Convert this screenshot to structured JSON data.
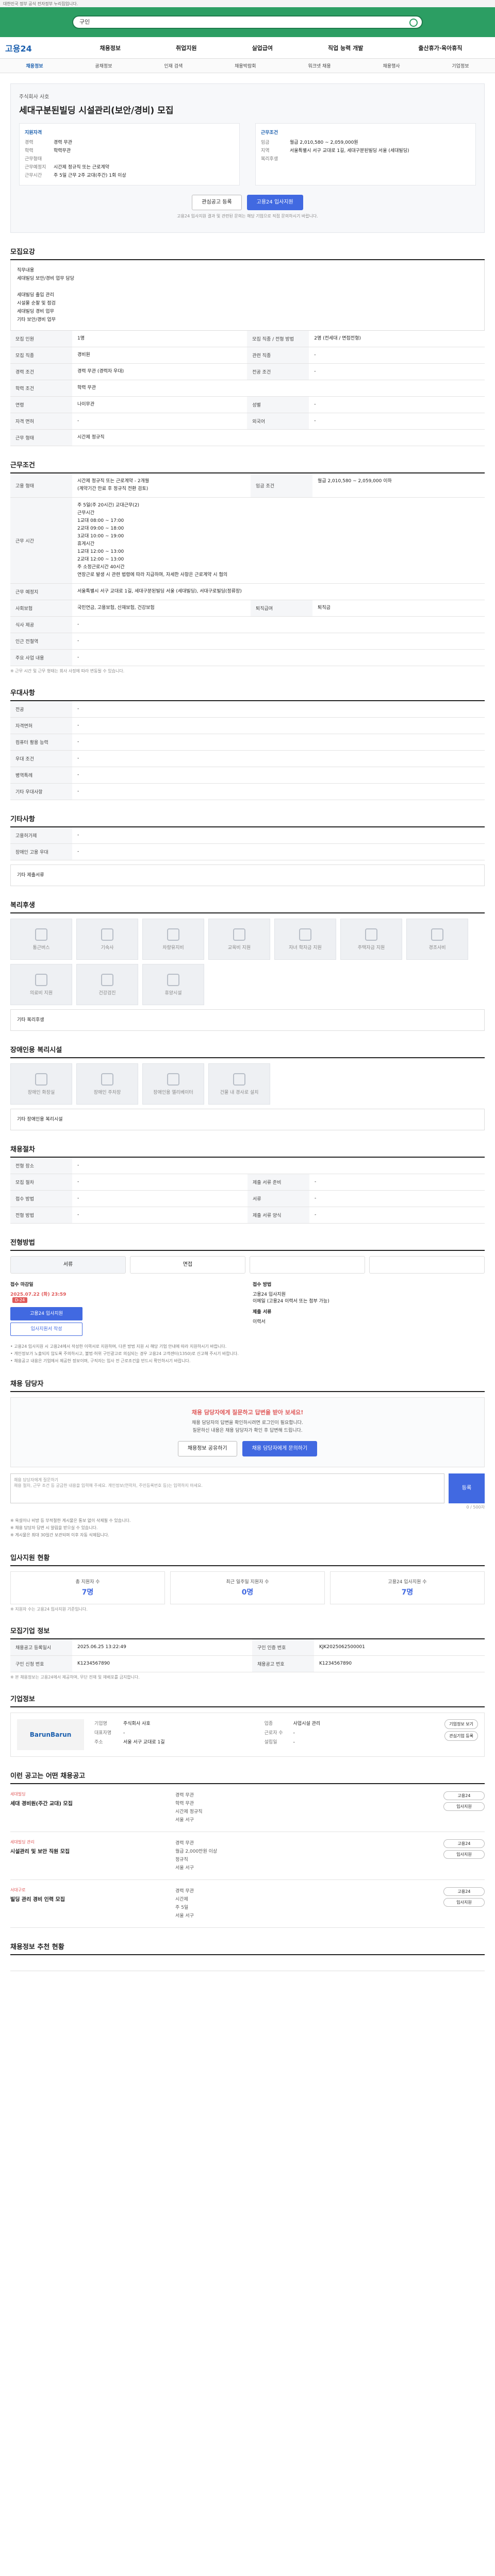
{
  "topbar": {
    "text": "대한민국 정부 공식 전자정부 누리집입니다."
  },
  "search": {
    "value": "구인"
  },
  "header": {
    "logo": "고용24",
    "gnb": [
      "채용정보",
      "취업지원",
      "실업급여",
      "직업 능력 개발",
      "출산휴가·육아휴직"
    ]
  },
  "subnav": [
    "채용정보",
    "공채정보",
    "인재 검색",
    "채용박람회",
    "워크넷 채용",
    "채용행사",
    "기업정보"
  ],
  "job": {
    "company": "주식회사 사호",
    "title": "세대구분된빌딩 시설관리(보안/경비) 모집",
    "left_header": "지원자격",
    "left": [
      {
        "k": "경력",
        "v": "경력 무관"
      },
      {
        "k": "학력",
        "v": "학력무관"
      },
      {
        "k": "",
        "v": ""
      },
      {
        "k": "근무형태",
        "v": ""
      },
      {
        "k": "근무예정지",
        "v": "시간제 정규직 또는 근로계약"
      },
      {
        "k": "근무시간",
        "v": "주 5일 근무 2주 교대(주간) 1회 이상"
      }
    ],
    "right_header": "근무조건",
    "right": [
      {
        "k": "임금",
        "v": "월급 2,010,580 ~ 2,059,000원"
      },
      {
        "k": "지역",
        "v": "서울특별시 서구 교대로 1길, 세대구분된빌딩 서울 (세대빌딩)"
      },
      {
        "k": "",
        "v": ""
      },
      {
        "k": "복리후생",
        "v": ""
      }
    ],
    "bookmark": "관심공고 등록",
    "apply": "고용24 입사지원",
    "notice": "고용24 입사지원 결과 및 관련된 문의는 해당 기업으로 직접 문의하시기 바랍니다."
  },
  "sections": {
    "duty": "모집요강",
    "conditions": "근무조건",
    "qualify": "우대사항",
    "etc": "기타사항",
    "welfare": "복리후생",
    "disabled": "장애인용 복리시설",
    "process": "채용절차",
    "apply_method": "전형방법",
    "qa": "채용 담당자",
    "stats": "입사지원 현황",
    "job_info": "모집기업 정보",
    "company": "기업정보",
    "recommend": "이런 공고는 어떤 채용공고"
  },
  "duty": {
    "desc": "직무내용\n세대빌딩 보안/경비 업무 담당\n\n세대빌딩 출입 관리\n시설물 순찰 및 점검\n세대빌딩 경비 업무\n기타 보안/경비 업무",
    "rows": [
      {
        "k": "모집 인원",
        "v": "1명",
        "k2": "모집 직종 / 전형 방법",
        "v2": "2명 (전세대 / 면접전형)"
      },
      {
        "k": "모집 직종",
        "v": "경비원",
        "k2": "관련 직종",
        "v2": "-"
      },
      {
        "k": "경력 조건",
        "v": "경력 무관 (경력자 우대)",
        "k2": "전공 조건",
        "v2": "-"
      },
      {
        "k": "학력 조건",
        "v": "학력 무관",
        "k2": "",
        "v2": ""
      },
      {
        "k": "연령",
        "v": "나이무관",
        "k2": "성별",
        "v2": "-"
      },
      {
        "k": "자격 면허",
        "v": "-",
        "k2": "외국어",
        "v2": "-"
      },
      {
        "k": "근무 형태",
        "v": "시간제 정규직",
        "k2": "",
        "v2": ""
      }
    ]
  },
  "cond": {
    "rows": [
      {
        "k": "고용 형태",
        "v": "시간제 정규직 또는 근로계약 - 2개월\n(계약기간 만료 후 정규직 전환 검토)",
        "k2": "임금 조건",
        "v2": "월급 2,010,580 ~ 2,059,000 이하"
      },
      {
        "k": "근무 시간",
        "v": "주 5일(주 20시간) 교대근무(2)\n근무시간\n1교대 08:00 ~ 17:00\n2교대 09:00 ~ 18:00\n3교대 10:00 ~ 19:00\n휴게시간\n1교대 12:00 ~ 13:00\n2교대 12:00 ~ 13:00\n주 소정근로시간 40시간\n연장근로 발생 시 관련 법령에 따라 지급하며, 자세한 사항은 근로계약 시 협의",
        "k2": "",
        "v2": ""
      },
      {
        "k": "근무 예정지",
        "v": "서울특별시 서구 교대로 1길, 세대구분된빌딩 서울 (세대빌딩), 서대구로빌딩(정류장)",
        "k2": "",
        "v2": ""
      },
      {
        "k": "사회보험",
        "v": "국민연금, 고용보험, 산재보험, 건강보험",
        "k2": "퇴직급여",
        "v2": "퇴직금"
      },
      {
        "k": "식사 제공",
        "v": "-",
        "k2": "",
        "v2": ""
      },
      {
        "k": "인근 전철역",
        "v": "-",
        "k2": "",
        "v2": ""
      },
      {
        "k": "주요 사업 내용",
        "v": "-",
        "k2": "",
        "v2": ""
      }
    ],
    "note": "※ 근무 시간 및 근무 형태는 회사 사정에 따라 변동될 수 있습니다."
  },
  "qualify": {
    "rows": [
      {
        "k": "전공",
        "v": "-"
      },
      {
        "k": "자격면허",
        "v": "-"
      },
      {
        "k": "컴퓨터 활용 능력",
        "v": "-"
      },
      {
        "k": "우대 조건",
        "v": "-"
      },
      {
        "k": "병역특례",
        "v": "-"
      },
      {
        "k": "기타 우대사항",
        "v": "-"
      }
    ]
  },
  "etc": {
    "rows": [
      {
        "k": "고용허가제",
        "v": "-"
      },
      {
        "k": "장애인 고용 우대",
        "v": "-"
      }
    ],
    "extra": "기타 제출서류"
  },
  "welfare": {
    "items": [
      "통근버스",
      "기숙사",
      "차량유지비",
      "교육비 지원",
      "자녀 학자금 지원",
      "주택자금 지원",
      "경조사비",
      "의료비 지원",
      "건강검진",
      "휴양시설"
    ],
    "extra_label": "기타 복리후생"
  },
  "disabled": {
    "items": [
      "장애인 화장실",
      "장애인 주차장",
      "장애인용 엘리베이터",
      "건물 내 경사로 설치"
    ],
    "extra_label": "기타 장애인용 복리시설"
  },
  "process": {
    "rows": [
      {
        "k": "전형 장소",
        "v": "-",
        "k2": "",
        "v2": ""
      },
      {
        "k": "모집 절차",
        "v": "-",
        "k2": "제출 서류 준비",
        "v2": "-"
      },
      {
        "k": "접수 방법",
        "v": "-",
        "k2": "서류",
        "v2": "-"
      },
      {
        "k": "전형 방법",
        "v": "-",
        "k2": "제출 서류 양식",
        "v2": "-"
      }
    ]
  },
  "apply": {
    "tabs": [
      "서류",
      "면접",
      "",
      ""
    ],
    "deadline_label": "접수 마감일",
    "deadline": "2025.07.22 (화) 23:59",
    "dday": "D-24",
    "apply_btn": "고용24 입사지원",
    "ghost_btn": "입사지원서 작성",
    "method_label": "접수 방법",
    "method_lines": [
      "고용24 입사지원",
      "이메일 (고용24 이력서 또는 첨부 가능)"
    ],
    "docs_label": "제출 서류",
    "docs": "이력서"
  },
  "notes": [
    "고용24 입사지원 시 고용24에서 작성한 이력서로 지원하며, 다른 방법 지원 시 해당 기업 안내에 따라 지원하시기 바랍니다.",
    "개인정보가 노출되지 않도록 주의하시고, 불법·허위 구인광고로 의심되는 경우 고용24 고객센터(1350)로 신고해 주시기 바랍니다.",
    "채용공고 내용은 기업에서 제공한 정보이며, 구직자는 입사 전 근로조건을 반드시 확인하시기 바랍니다."
  ],
  "qa": {
    "title": "채용 담당자에게 질문하고 답변을 받아 보세요!",
    "sub": "채용 담당자의 답변을 확인하시려면 로그인이 필요합니다.\n질문하신 내용은 채용 담당자가 확인 후 답변해 드립니다.",
    "btn1": "채용정보 공유하기",
    "btn2": "채용 담당자에게 문의하기",
    "placeholder": "채용 담당자에게 질문하기\n채용 절차, 근무 조건 등 궁금한 내용을 입력해 주세요. 개인정보(연락처, 주민등록번호 등)는 입력하지 마세요.",
    "count": "0 / 500자",
    "send": "등록",
    "footnotes": [
      "※ 욕설이나 비방 등 부적절한 게시물은 통보 없이 삭제될 수 있습니다.",
      "※ 채용 담당자 답변 시 알림을 받으실 수 있습니다.",
      "※ 게시물은 최대 30일간 보관되며 이후 자동 삭제됩니다."
    ]
  },
  "stats": {
    "items": [
      {
        "label": "총 지원자 수",
        "value": "7명"
      },
      {
        "label": "최근 일주일 지원자 수",
        "value": "0명"
      },
      {
        "label": "고용24 입사지원 수",
        "value": "7명"
      }
    ],
    "note": "※ 지원자 수는 고용24 입사지원 기준입니다."
  },
  "job_info": {
    "rows": [
      {
        "k": "채용공고 등록일시",
        "v": "2025.06.25 13:22:49",
        "k2": "구인 인증 번호",
        "v2": "KJK2025062500001"
      },
      {
        "k": "구인 신청 번호",
        "v": "K1234567890",
        "k2": "채용공고 번호",
        "v2": "K1234567890"
      }
    ],
    "note": "※ 본 채용정보는 고용24에서 제공하며, 무단 전재 및 재배포를 금지합니다."
  },
  "company": {
    "logo": "BarunBarun",
    "rows": [
      {
        "k": "기업명",
        "v": "주식회사 사호",
        "k2": "업종",
        "v2": "사업시설 관리"
      },
      {
        "k": "대표자명",
        "v": "-",
        "k2": "근로자 수",
        "v2": "-"
      },
      {
        "k": "주소",
        "v": "서울 서구 교대로 1길",
        "k2": "설립일",
        "v2": "-"
      }
    ],
    "btns": [
      "기업정보 보기",
      "관심기업 등록"
    ]
  },
  "recommend": [
    {
      "company": "세대빌딩",
      "title": "세대 경비원(주간 교대) 모집",
      "lines": [
        "경력 무관",
        "학력 무관",
        "시간제 정규직",
        "서울 서구"
      ],
      "btns": [
        "고용24",
        "입사지원"
      ]
    },
    {
      "company": "세대빌딩 관리",
      "title": "시설관리 및 보안 직원 모집",
      "lines": [
        "경력 무관",
        "월급 2,000만원 이상",
        "정규직",
        "서울 서구"
      ],
      "btns": [
        "고용24",
        "입사지원"
      ]
    },
    {
      "company": "서대구로",
      "title": "빌딩 관리 경비 인력 모집",
      "lines": [
        "경력 무관",
        "시간제",
        "주 5일",
        "서울 서구"
      ],
      "btns": [
        "고용24",
        "입사지원"
      ]
    }
  ],
  "bottom_title": "채용정보 추천 현황"
}
